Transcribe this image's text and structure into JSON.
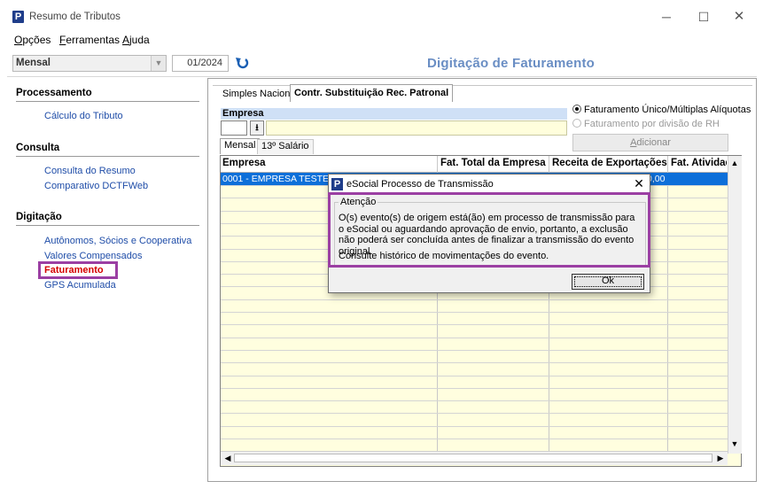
{
  "window": {
    "title": "Resumo de Tributos",
    "app_icon": "P",
    "minimize_icon": "─",
    "maximize_icon": "☐",
    "close_icon": "✕"
  },
  "menu": {
    "items": [
      {
        "label": "Opções",
        "mnemonic": "O",
        "rest": "pções"
      },
      {
        "label": "Ferramentas",
        "mnemonic": "F",
        "rest": "erramentas"
      },
      {
        "label": "Ajuda",
        "mnemonic": "A",
        "rest": "juda"
      }
    ]
  },
  "toolbar": {
    "period": "Mensal",
    "date": "01/2024",
    "refresh_icon": "refresh-back-icon"
  },
  "page_title": "Digitação de Faturamento",
  "sidebar": {
    "sections": [
      {
        "title": "Processamento",
        "items": [
          "Cálculo do Tributo"
        ]
      },
      {
        "title": "Consulta",
        "items": [
          "Consulta do Resumo",
          "Comparativo DCTFWeb"
        ]
      },
      {
        "title": "Digitação",
        "items": [
          "Autônomos, Sócios e Cooperativa",
          "Valores Compensados",
          "Faturamento",
          "GPS Acumulada"
        ]
      }
    ],
    "active_item": "Faturamento"
  },
  "tabs": {
    "items": [
      "Simples Nacional",
      "Contr. Substituição Rec. Patronal"
    ],
    "active": "Contr. Substituição Rec. Patronal"
  },
  "empresa": {
    "label": "Empresa",
    "code": "",
    "name": "",
    "lookup_icon": "⭳"
  },
  "options": {
    "radio1": "Faturamento Único/Múltiplas Alíquotas",
    "radio2": "Faturamento por divisão de RH",
    "selected": "radio1",
    "add_button": {
      "mnemonic": "A",
      "rest": "dicionar"
    }
  },
  "subtabs": {
    "items": [
      "Mensal",
      "13º Salário"
    ],
    "active": "Mensal"
  },
  "grid": {
    "columns": [
      "Empresa",
      "Fat. Total da Empresa",
      "Receita de Exportações",
      "Fat. Atividades"
    ],
    "rows": [
      {
        "empresa": "0001 - EMPRESA TESTE",
        "value": "0,00"
      }
    ]
  },
  "dialog": {
    "title": "eSocial Processo de Transmissão",
    "group_label": "Atenção",
    "message": "O(s) evento(s) de origem  está(ão) em processo de transmissão para o eSocial ou aguardando aprovação de envio, portanto, a exclusão não poderá ser concluída antes de finalizar a transmissão do evento original.",
    "message2": "Consulte histórico de movimentações do evento.",
    "ok_label": "Ok"
  },
  "colors": {
    "highlight": "#9b3fa3",
    "title_blue": "#6a8ec4",
    "link_blue": "#1f4da8",
    "active_red": "#d40000",
    "selection": "#0d6fd9",
    "grid_bg": "#fffedf"
  }
}
